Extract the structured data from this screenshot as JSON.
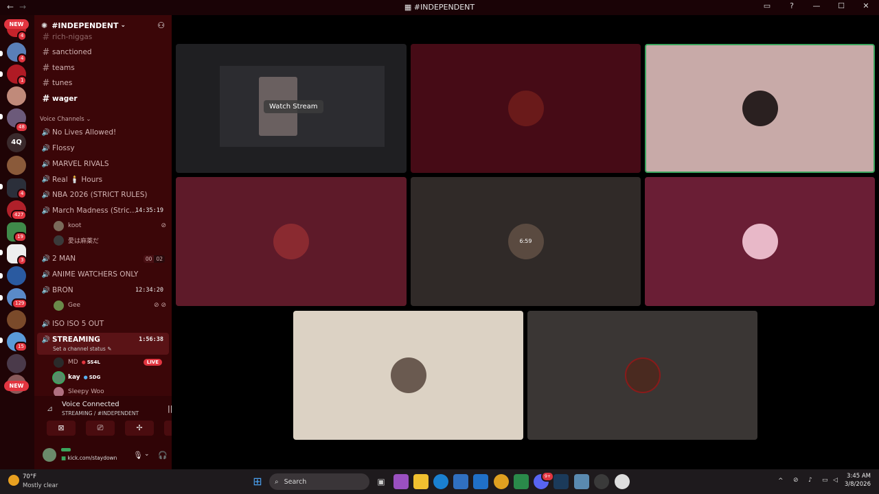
{
  "window": {
    "title": "#INDEPENDENT",
    "back": "←",
    "forward": "→"
  },
  "servers": {
    "new_top": "NEW",
    "new_bottom": "NEW",
    "text_server": "4Q",
    "badges": [
      "4",
      "4",
      "1",
      "48",
      "4",
      "427",
      "19",
      "3",
      "129",
      "15"
    ]
  },
  "guild": {
    "name": "#INDEPENDENT"
  },
  "text_channels": [
    "rich-niggas",
    "sanctioned",
    "teams",
    "tunes",
    "wager"
  ],
  "voice_category": "Voice Channels",
  "voice_channels": {
    "no_lives": "No Lives Allowed!",
    "flossy": "Flossy",
    "marvel": "MARVEL RIVALS",
    "real_hours": "Real 🕯️ Hours",
    "nba": "NBA 2026 (STRICT RULES)",
    "march": "March Madness (Stric...",
    "march_time": "14:35:19",
    "march_users": [
      "koot",
      "愛は麻薬だ"
    ],
    "two_man": "2 MAN",
    "two_man_counts": [
      "00",
      "02"
    ],
    "anime": "ANIME WATCHERS ONLY",
    "bron": "BRON",
    "bron_time": "12:34:20",
    "bron_user": "Gee",
    "iso": "ISO ISO 5 OUT",
    "streaming": "STREAMING",
    "streaming_time": "1:56:38",
    "streaming_status": "Set a channel status",
    "streaming_users": [
      {
        "name": "MD",
        "tag": "SS4L",
        "live": "LIVE"
      },
      {
        "name": "kay",
        "tag": "SDG"
      },
      {
        "name": "Sleepy Woo"
      }
    ]
  },
  "voice_panel": {
    "title": "Voice Connected",
    "subtitle": "STREAMING / #INDEPENDENT"
  },
  "user_panel": {
    "status": "kick.com/staydown"
  },
  "stage": {
    "watch_stream": "Watch Stream",
    "tile_clock": "6:59"
  },
  "taskbar": {
    "temp": "70°F",
    "weather": "Mostly clear",
    "search": "Search",
    "time": "3:45 AM",
    "date": "3/8/2026",
    "discord_badge": "9+"
  },
  "colors": {
    "accent": "#e23540",
    "sidebar": "#3b0608",
    "servers": "#1f0406",
    "speaking": "#3ba55d"
  }
}
